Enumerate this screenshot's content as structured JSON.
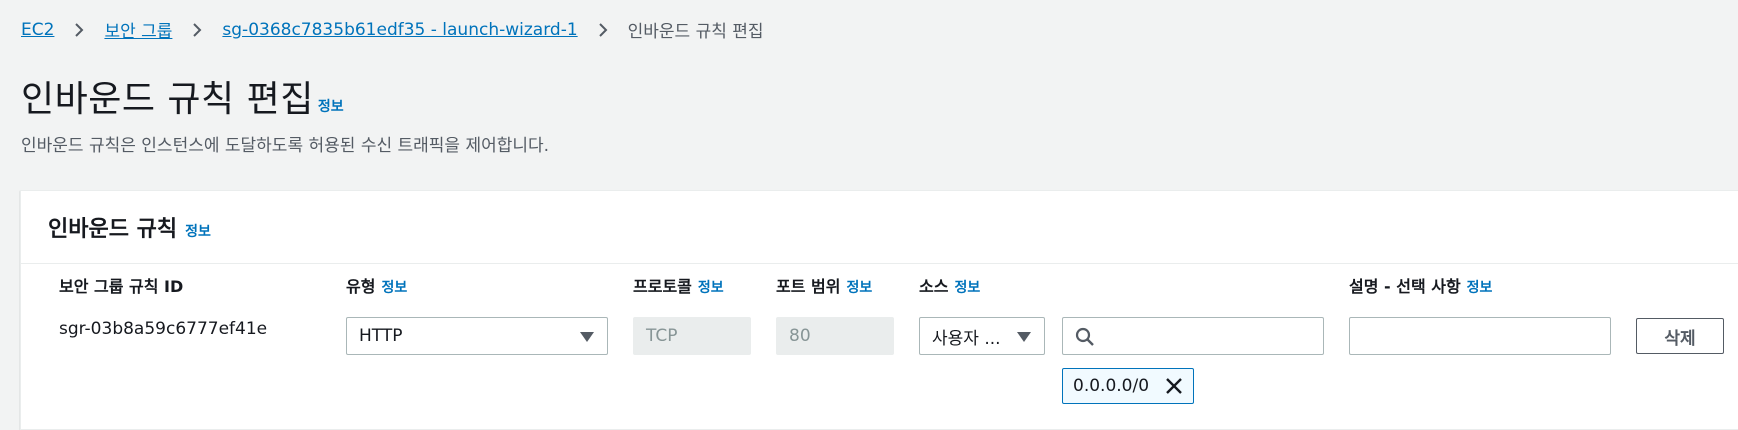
{
  "breadcrumb": {
    "items": [
      {
        "label": "EC2"
      },
      {
        "label": "보안 그룹"
      },
      {
        "label": "sg-0368c7835b61edf35 - launch-wizard-1"
      }
    ],
    "current": "인바운드 규칙 편집"
  },
  "page": {
    "title": "인바운드 규칙 편집",
    "info": "정보",
    "description": "인바운드 규칙은 인스턴스에 도달하도록 허용된 수신 트래픽을 제어합니다."
  },
  "panel": {
    "title": "인바운드 규칙",
    "info": "정보",
    "columns": {
      "rule_id": "보안 그룹 규칙 ID",
      "type": "유형",
      "protocol": "프로토콜",
      "port_range": "포트 범위",
      "source": "소스",
      "description": "설명 - 선택 사항",
      "info": "정보"
    },
    "row": {
      "rule_id": "sgr-03b8a59c6777ef41e",
      "type": "HTTP",
      "protocol": "TCP",
      "port_range": "80",
      "source_type": "사용자 ...",
      "source_search_value": "",
      "source_token": "0.0.0.0/0",
      "description_value": "",
      "delete_label": "삭제"
    }
  },
  "colors": {
    "link": "#0073bb",
    "background": "#f2f3f3",
    "token_border": "#0073bb"
  }
}
